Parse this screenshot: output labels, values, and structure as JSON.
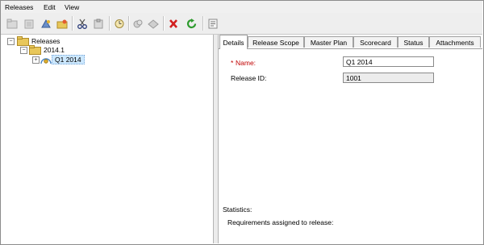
{
  "menu": [
    "Releases",
    "Edit",
    "View"
  ],
  "toolbar": {
    "icons": [
      "new-folder-icon",
      "new-release-icon",
      "new-cycle-icon",
      "open-icon",
      "cut-icon",
      "paste-icon",
      "schedule-icon",
      "refresh-linked-icon",
      "send-icon",
      "delete-icon",
      "refresh-icon",
      "details-icon"
    ]
  },
  "tree": {
    "root": "Releases",
    "folder": "2014.1",
    "release": "Q1 2014",
    "expanders": [
      "−",
      "−",
      "+"
    ]
  },
  "tabs": [
    "Details",
    "Release Scope",
    "Master Plan",
    "Scorecard",
    "Status",
    "Attachments"
  ],
  "active_tab": "Details",
  "details": {
    "required_marker": "*",
    "name_label": "Name:",
    "name_value": "Q1 2014",
    "release_id_label": "Release ID:",
    "release_id_value": "1001",
    "statistics_label": "Statistics:",
    "requirements_label": "Requirements assigned to release:"
  },
  "colors": {
    "required": "#c00000",
    "selection": "#cce8ff",
    "delete_icon": "#d21f1f",
    "refresh_icon": "#2e9b2e",
    "folder": "#e8c75a"
  }
}
